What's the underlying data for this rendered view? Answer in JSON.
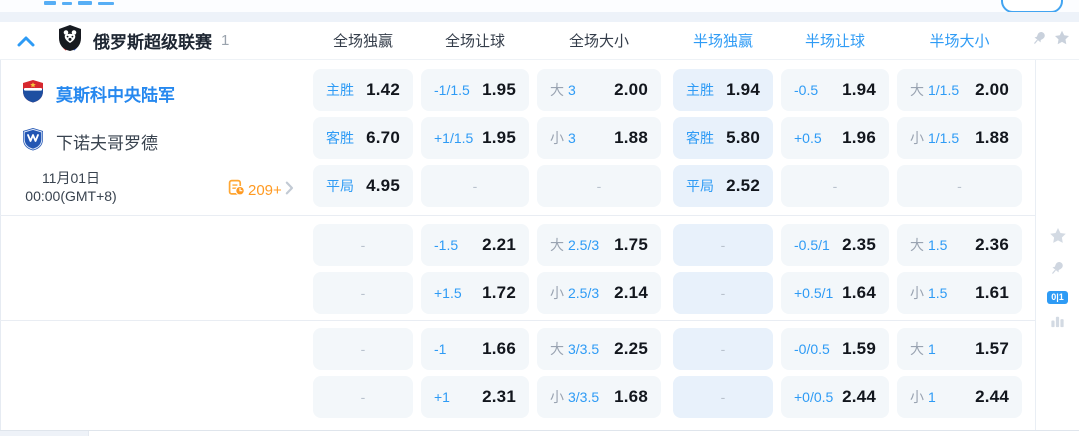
{
  "league": {
    "name": "俄罗斯超级联赛",
    "count": "1"
  },
  "columns": [
    {
      "label": "全场独赢"
    },
    {
      "label": "全场让球"
    },
    {
      "label": "全场大小"
    },
    {
      "label": "半场独赢"
    },
    {
      "label": "半场让球"
    },
    {
      "label": "半场大小"
    }
  ],
  "teams": {
    "home": "莫斯科中央陆军",
    "away": "下诺夫哥罗德"
  },
  "schedule": {
    "date": "11月01日",
    "time": "00:00(GMT+8)"
  },
  "more_markets": {
    "count": "209+"
  },
  "rail": {
    "badge": "0|1"
  },
  "colors": {
    "accent_blue": "#2e9bf5",
    "home_team_blue": "#2688ef",
    "orange": "#ff9a22",
    "cell_bg": "#f3f7fa",
    "highlight_cell_bg": "#e8f1fb",
    "odds_text": "#12161d"
  },
  "sections": [
    {
      "rows": [
        [
          {
            "kind": "win",
            "label": "主胜",
            "odds": "1.42"
          },
          {
            "kind": "hcp",
            "label": "-1/1.5",
            "odds": "1.95"
          },
          {
            "kind": "ou",
            "prefix": "大",
            "line": "3",
            "odds": "2.00"
          },
          {
            "kind": "win",
            "label": "主胜",
            "odds": "1.94",
            "hl": true
          },
          {
            "kind": "hcp",
            "label": "-0.5",
            "odds": "1.94"
          },
          {
            "kind": "ou",
            "prefix": "大",
            "line": "1/1.5",
            "odds": "2.00"
          }
        ],
        [
          {
            "kind": "win",
            "label": "客胜",
            "odds": "6.70"
          },
          {
            "kind": "hcp",
            "label": "+1/1.5",
            "odds": "1.95"
          },
          {
            "kind": "ou",
            "prefix": "小",
            "line": "3",
            "odds": "1.88"
          },
          {
            "kind": "win",
            "label": "客胜",
            "odds": "5.80",
            "hl": true
          },
          {
            "kind": "hcp",
            "label": "+0.5",
            "odds": "1.96"
          },
          {
            "kind": "ou",
            "prefix": "小",
            "line": "1/1.5",
            "odds": "1.88"
          }
        ],
        [
          {
            "kind": "win",
            "label": "平局",
            "odds": "4.95"
          },
          {
            "kind": "dash"
          },
          {
            "kind": "dash"
          },
          {
            "kind": "win",
            "label": "平局",
            "odds": "2.52",
            "hl": true
          },
          {
            "kind": "dash"
          },
          {
            "kind": "dash"
          }
        ]
      ]
    },
    {
      "rows": [
        [
          {
            "kind": "dash"
          },
          {
            "kind": "hcp",
            "label": "-1.5",
            "odds": "2.21"
          },
          {
            "kind": "ou",
            "prefix": "大",
            "line": "2.5/3",
            "odds": "1.75"
          },
          {
            "kind": "dash",
            "hl": true
          },
          {
            "kind": "hcp",
            "label": "-0.5/1",
            "odds": "2.35"
          },
          {
            "kind": "ou",
            "prefix": "大",
            "line": "1.5",
            "odds": "2.36"
          }
        ],
        [
          {
            "kind": "dash"
          },
          {
            "kind": "hcp",
            "label": "+1.5",
            "odds": "1.72"
          },
          {
            "kind": "ou",
            "prefix": "小",
            "line": "2.5/3",
            "odds": "2.14"
          },
          {
            "kind": "dash",
            "hl": true
          },
          {
            "kind": "hcp",
            "label": "+0.5/1",
            "odds": "1.64"
          },
          {
            "kind": "ou",
            "prefix": "小",
            "line": "1.5",
            "odds": "1.61"
          }
        ]
      ]
    },
    {
      "rows": [
        [
          {
            "kind": "dash"
          },
          {
            "kind": "hcp",
            "label": "-1",
            "odds": "1.66"
          },
          {
            "kind": "ou",
            "prefix": "大",
            "line": "3/3.5",
            "odds": "2.25"
          },
          {
            "kind": "dash",
            "hl": true
          },
          {
            "kind": "hcp",
            "label": "-0/0.5",
            "odds": "1.59"
          },
          {
            "kind": "ou",
            "prefix": "大",
            "line": "1",
            "odds": "1.57"
          }
        ],
        [
          {
            "kind": "dash"
          },
          {
            "kind": "hcp",
            "label": "+1",
            "odds": "2.31"
          },
          {
            "kind": "ou",
            "prefix": "小",
            "line": "3/3.5",
            "odds": "1.68"
          },
          {
            "kind": "dash",
            "hl": true
          },
          {
            "kind": "hcp",
            "label": "+0/0.5",
            "odds": "2.44"
          },
          {
            "kind": "ou",
            "prefix": "小",
            "line": "1",
            "odds": "2.44"
          }
        ]
      ]
    }
  ]
}
